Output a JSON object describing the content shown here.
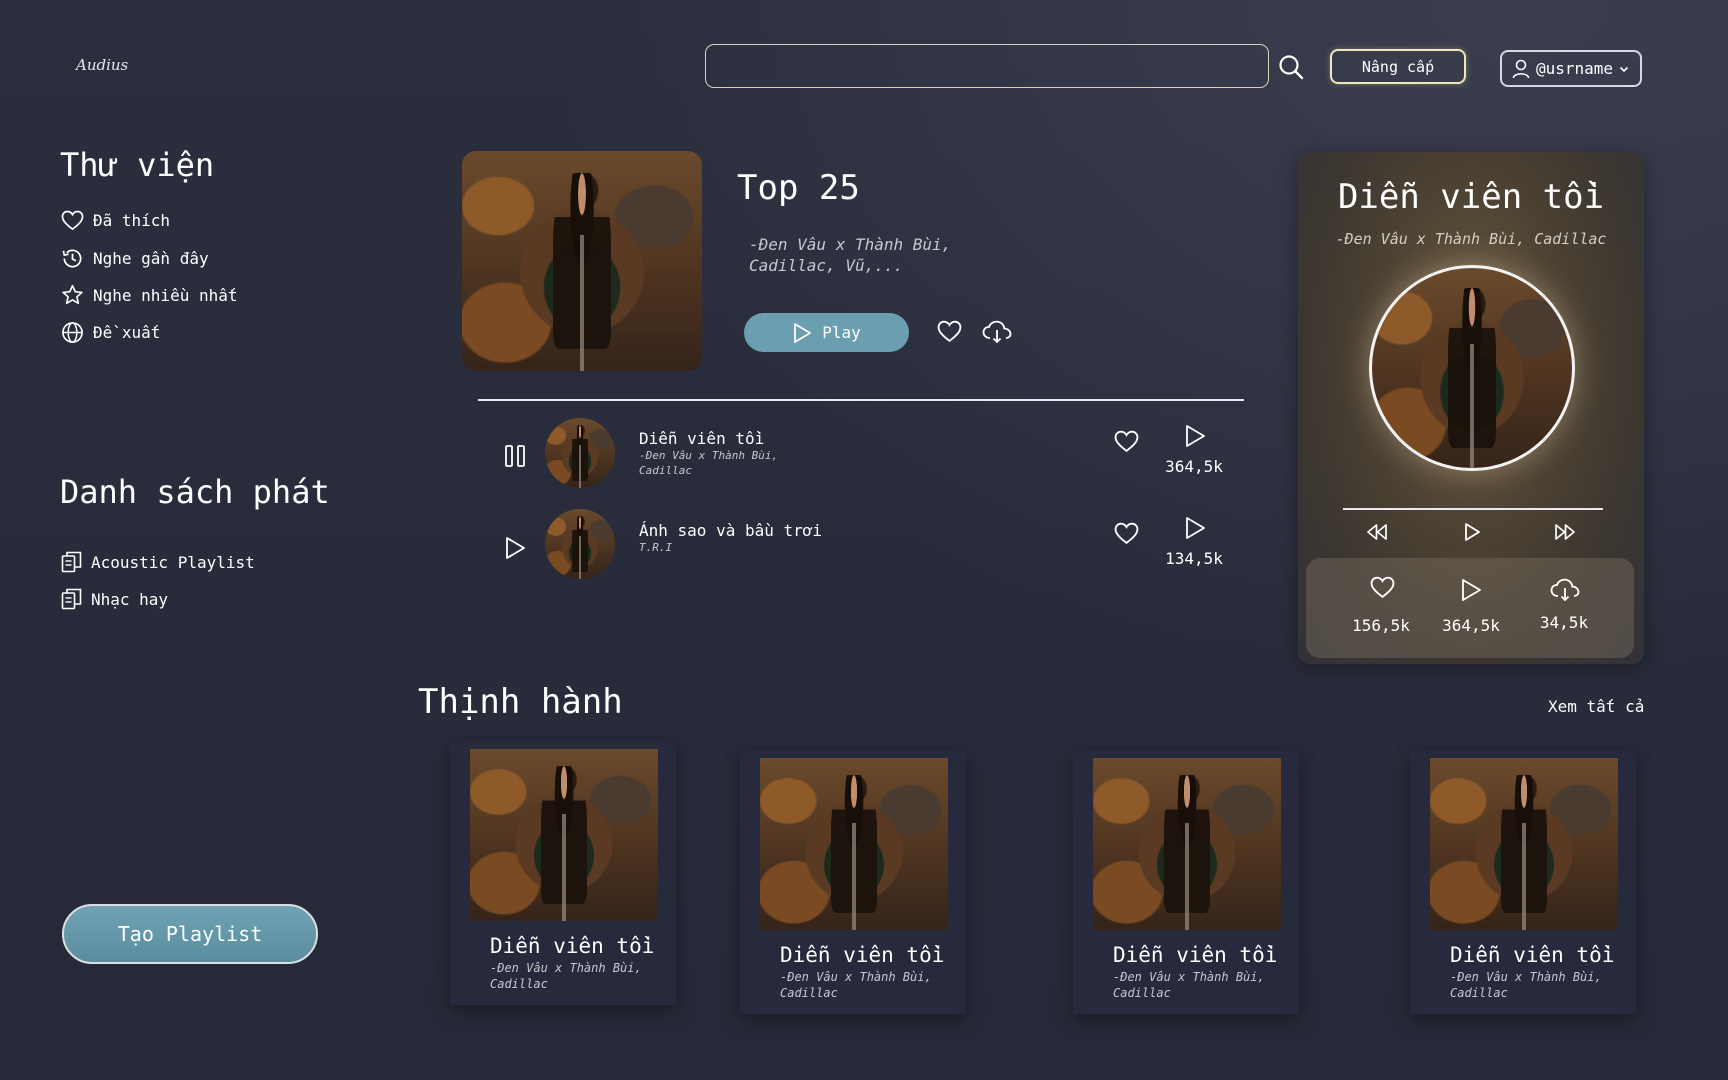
{
  "header": {
    "logo": "Audius",
    "search_placeholder": "",
    "upgrade_label": "Nâng cấp",
    "username": "@usrname"
  },
  "library": {
    "title": "Thư viện",
    "items": [
      {
        "label": "Đã thích",
        "icon": "heart-icon"
      },
      {
        "label": "Nghe gần đây",
        "icon": "history-icon"
      },
      {
        "label": "Nghe nhiều nhất",
        "icon": "star-icon"
      },
      {
        "label": "Đề xuất",
        "icon": "globe-icon"
      }
    ]
  },
  "playlists": {
    "title": "Danh sách phát",
    "items": [
      {
        "label": "Acoustic Playlist",
        "icon": "playlist-icon"
      },
      {
        "label": "Nhạc hay",
        "icon": "playlist-icon"
      }
    ],
    "create_label": "Tạo Playlist"
  },
  "featured": {
    "title": "Top 25",
    "artists": "-Đen Vâu x Thành Bùi, Cadillac, Vũ,...",
    "play_label": "Play"
  },
  "tracks": [
    {
      "title": "Diễn viên tồi",
      "artist": "-Đen Vâu x Thành Bùi, Cadillac",
      "plays": "364,5k",
      "state": "playing"
    },
    {
      "title": "Ánh sao và bầu trơi",
      "artist": "T.R.I",
      "plays": "134,5k",
      "state": "paused"
    }
  ],
  "now_playing": {
    "title": "Diễn viên tồi",
    "artist": "-Đen Vâu x Thành Bùi, Cadillac",
    "likes": "156,5k",
    "plays": "364,5k",
    "downloads": "34,5k"
  },
  "trending": {
    "title": "Thịnh hành",
    "see_all": "Xem tất cả",
    "cards": [
      {
        "title": "Diễn viên tồi",
        "artist": "-Đen Vâu x Thành Bùi, Cadillac"
      },
      {
        "title": "Diễn viên tồi",
        "artist": "-Đen Vâu x Thành Bùi, Cadillac"
      },
      {
        "title": "Diễn viên tồi",
        "artist": "-Đen Vâu x Thành Bùi, Cadillac"
      },
      {
        "title": "Diễn viên tồi",
        "artist": "-Đen Vâu x Thành Bùi, Cadillac"
      }
    ]
  },
  "colors": {
    "background": "#272b3a",
    "accent": "#6b9eb0",
    "upgrade_border": "#efe7b4"
  }
}
